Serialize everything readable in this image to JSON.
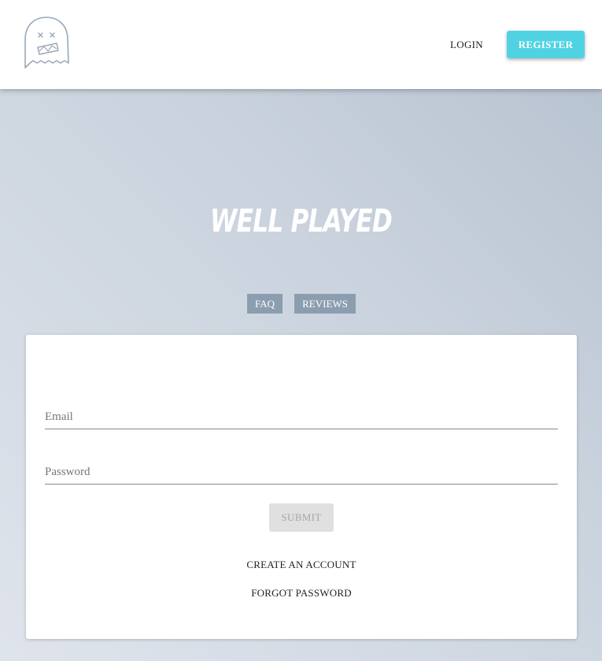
{
  "header": {
    "logo_icon": "ghost-logo-icon",
    "nav": {
      "login_label": "LOGIN",
      "register_label": "REGISTER"
    }
  },
  "hero": {
    "title": "WELL PLAYED"
  },
  "tabs": [
    {
      "label": "FAQ"
    },
    {
      "label": "REVIEWS"
    }
  ],
  "login_form": {
    "email": {
      "placeholder": "Email",
      "value": ""
    },
    "password": {
      "placeholder": "Password",
      "value": ""
    },
    "submit_label": "SUBMIT",
    "create_account_label": "CREATE AN ACCOUNT",
    "forgot_password_label": "FORGOT PASSWORD"
  },
  "colors": {
    "accent": "#4fd3e3",
    "tab_background": "#8b9eb0",
    "header_background": "#ffffff",
    "disabled_button": "#e0e0e0"
  }
}
